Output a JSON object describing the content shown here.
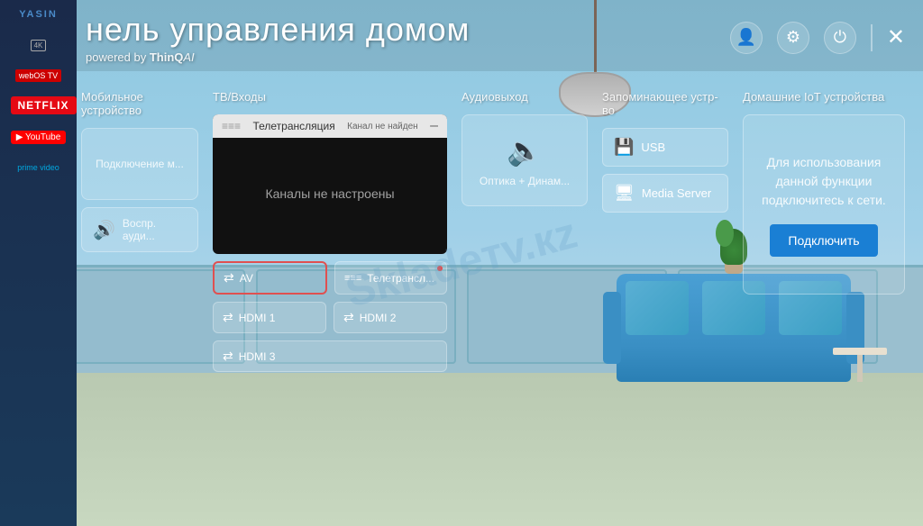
{
  "app": {
    "title": "нель управления домом",
    "subtitle_pre": "powered by ",
    "subtitle_brand": "ThinQ",
    "subtitle_ai": "AI",
    "logo": "YASIN"
  },
  "controls": {
    "profile_icon": "👤",
    "settings_icon": "⚙",
    "power_icon": "⏻",
    "close_icon": "✕"
  },
  "sidebar": {
    "logo": "YASIN",
    "items": [
      {
        "label": "4K",
        "type": "badge-4k"
      },
      {
        "label": "webOS TV",
        "type": "badge-webos"
      },
      {
        "label": "NETFLIX",
        "type": "badge-netflix"
      },
      {
        "label": "YouTube",
        "type": "badge-yt"
      },
      {
        "label": "prime video",
        "type": "badge-prime"
      }
    ]
  },
  "columns": {
    "mobile": {
      "label": "Мобильное устройство",
      "connect_label": "Подключение м..."
    },
    "audio_card": {
      "icon": "🔊",
      "label": "Воспр. ауди..."
    },
    "tv": {
      "label": "ТВ/Входы",
      "broadcast_title": "Телетрансляция",
      "broadcast_sub": "Канал не найден",
      "no_channels": "Каналы не настроены",
      "inputs": [
        {
          "id": "av",
          "icon": "⇄",
          "label": "AV",
          "active": true
        },
        {
          "id": "telecast",
          "icon": "≡≡≡",
          "label": "Телетрансл...",
          "active": false,
          "has_dot": true
        },
        {
          "id": "hdmi1",
          "icon": "⇄",
          "label": "HDMI 1",
          "active": false
        },
        {
          "id": "hdmi2",
          "icon": "⇄",
          "label": "HDMI 2",
          "active": false
        },
        {
          "id": "hdmi3",
          "icon": "⇄",
          "label": "HDMI 3",
          "active": false
        }
      ]
    },
    "audio_output": {
      "label": "Аудиовыход",
      "icon": "🔈",
      "text": "Оптика + Динам..."
    },
    "storage": {
      "label": "Запоминающее устр-во",
      "items": [
        {
          "id": "usb",
          "icon": "💾",
          "label": "USB"
        },
        {
          "id": "media-server",
          "icon": "🖥",
          "label": "Media Server"
        }
      ]
    },
    "iot": {
      "label": "Домашние IoT устройства",
      "text": "Для использования данной функции подключитесь к сети.",
      "connect_btn": "Подключить"
    }
  },
  "watermark": "Skladeтv.кz"
}
